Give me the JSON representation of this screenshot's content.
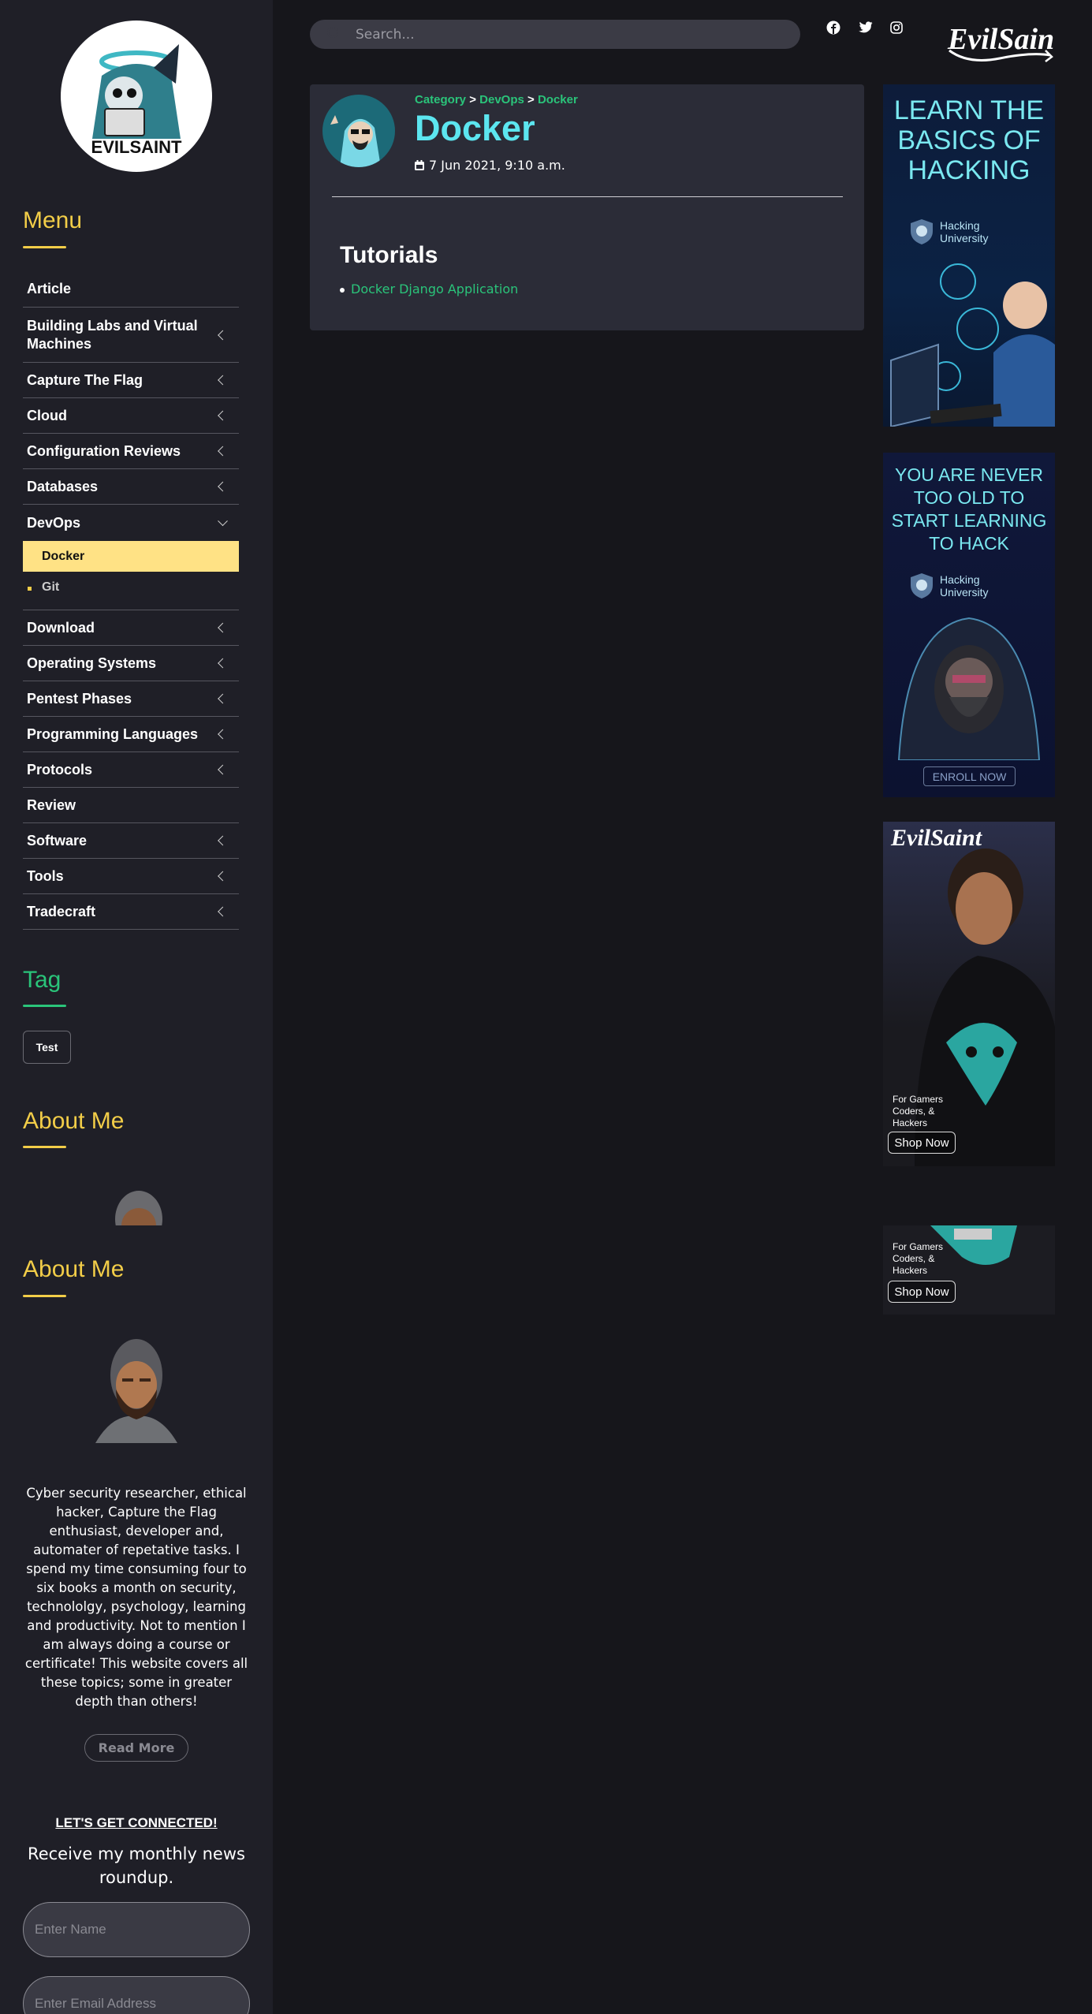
{
  "header": {
    "search_placeholder": "Search...",
    "social": [
      "facebook-icon",
      "twitter-icon",
      "instagram-icon"
    ],
    "brand_logo_text": "EvilSaint"
  },
  "sidebar": {
    "logo_text": "EVILSAINT",
    "menu_title": "Menu",
    "menu_items": [
      {
        "label": "Article",
        "chevron": false
      },
      {
        "label": "Building Labs and Virtual Machines",
        "chevron": true
      },
      {
        "label": "Capture The Flag",
        "chevron": true
      },
      {
        "label": "Cloud",
        "chevron": true
      },
      {
        "label": "Configuration Reviews",
        "chevron": true
      },
      {
        "label": "Databases",
        "chevron": true
      },
      {
        "label": "DevOps",
        "chevron": true,
        "expanded": true
      },
      {
        "label": "Download",
        "chevron": true
      },
      {
        "label": "Operating Systems",
        "chevron": true
      },
      {
        "label": "Pentest Phases",
        "chevron": true
      },
      {
        "label": "Programming Languages",
        "chevron": true
      },
      {
        "label": "Protocols",
        "chevron": true
      },
      {
        "label": "Review",
        "chevron": false
      },
      {
        "label": "Software",
        "chevron": true
      },
      {
        "label": "Tools",
        "chevron": true
      },
      {
        "label": "Tradecraft",
        "chevron": true
      }
    ],
    "devops_subitems": [
      {
        "label": "Docker",
        "active": true
      },
      {
        "label": "Git",
        "active": false
      }
    ],
    "tag_title": "Tag",
    "tags": [
      "Test"
    ],
    "about_title": "About Me",
    "about_title_2": "About Me",
    "about_text": "Cyber security researcher, ethical hacker, Capture the Flag enthusiast, developer and, automater of repetative tasks. I spend my time consuming four to six books a month on security, technololgy, psychology, learning and productivity. Not to mention I am always doing a course or certificate! This website covers all these topics; some in greater depth than others!",
    "read_more": "Read More",
    "connect_title": "LET'S GET CONNECTED!",
    "roundup": "Receive my monthly news roundup.",
    "name_placeholder": "Enter Name",
    "email_placeholder": "Enter Email Address"
  },
  "post": {
    "breadcrumb": {
      "category": "Category",
      "sep": ">",
      "parent": "DevOps",
      "current": "Docker"
    },
    "title": "Docker",
    "date": "7 Jun 2021, 9:10 a.m.",
    "section_title": "Tutorials",
    "tutorials": [
      "Docker Django Application"
    ]
  },
  "ads": {
    "ad1": {
      "lines": [
        "LEARN THE",
        "BASICS OF",
        "HACKING"
      ],
      "brand": [
        "Hacking",
        "University"
      ]
    },
    "ad2": {
      "lines": [
        "YOU ARE NEVER",
        "TOO OLD TO",
        "START LEARNING",
        "TO HACK"
      ],
      "brand": [
        "Hacking",
        "University"
      ],
      "cta": "ENROLL NOW"
    },
    "ad3": {
      "logo": "EvilSaint",
      "tagline": [
        "For Gamers",
        "Coders, &",
        "Hackers"
      ],
      "cta": "Shop Now"
    },
    "ad4": {
      "tagline": [
        "For Gamers",
        "Coders, &",
        "Hackers"
      ],
      "cta": "Shop Now"
    }
  },
  "colors": {
    "accent_yellow": "#f2cd48",
    "accent_green": "#2ac47a",
    "title_cyan": "#5ce6f0",
    "active_bg": "#ffe285"
  }
}
